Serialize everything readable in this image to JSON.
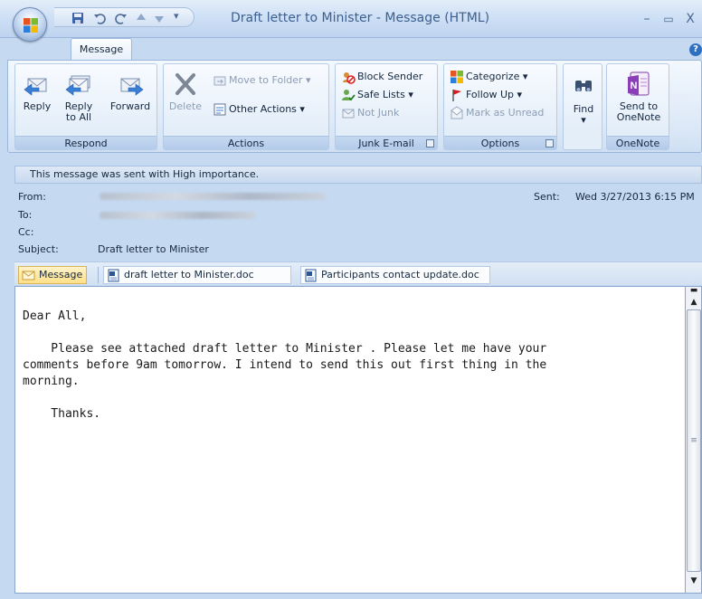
{
  "window": {
    "title": "Draft letter to Minister - Message (HTML)",
    "minimize": "–",
    "maximize": "▭",
    "close": "X"
  },
  "tabs": [
    {
      "label": "Message"
    }
  ],
  "ribbon": {
    "respond": {
      "label": "Respond",
      "reply": "Reply",
      "reply_all_line1": "Reply",
      "reply_all_line2": "to All",
      "forward": "Forward"
    },
    "actions": {
      "label": "Actions",
      "delete": "Delete",
      "move_to_folder": "Move to Folder",
      "other_actions": "Other Actions"
    },
    "junk": {
      "label": "Junk E-mail",
      "block_sender": "Block Sender",
      "safe_lists": "Safe Lists",
      "not_junk": "Not Junk"
    },
    "options": {
      "label": "Options",
      "categorize": "Categorize",
      "follow_up": "Follow Up",
      "mark_as_unread": "Mark as Unread"
    },
    "find": {
      "label": "Find"
    },
    "onenote": {
      "label": "OneNote",
      "send_line1": "Send to",
      "send_line2": "OneNote"
    }
  },
  "info_bar": "This message was sent with High importance.",
  "header": {
    "from_label": "From:",
    "to_label": "To:",
    "cc_label": "Cc:",
    "subject_label": "Subject:",
    "subject": "Draft letter to Minister",
    "sent_label": "Sent:",
    "sent_value": "Wed 3/27/2013 6:15 PM"
  },
  "attachments": [
    {
      "label": "Message"
    },
    {
      "label": "draft letter to Minister.doc"
    },
    {
      "label": "Participants contact update.doc"
    }
  ],
  "body": {
    "greeting": "Dear All,",
    "para_line1": "    Please see attached draft letter to Minister . Please let me have your",
    "para_line2": "comments before 9am tomorrow. I intend to send this out first thing in the",
    "para_line3": "morning.",
    "closing": "    Thanks."
  },
  "colors": {
    "accent": "#2d6fc1",
    "ribbon_bg": "#dde9f7",
    "info_bar": "#c8d9ef"
  }
}
